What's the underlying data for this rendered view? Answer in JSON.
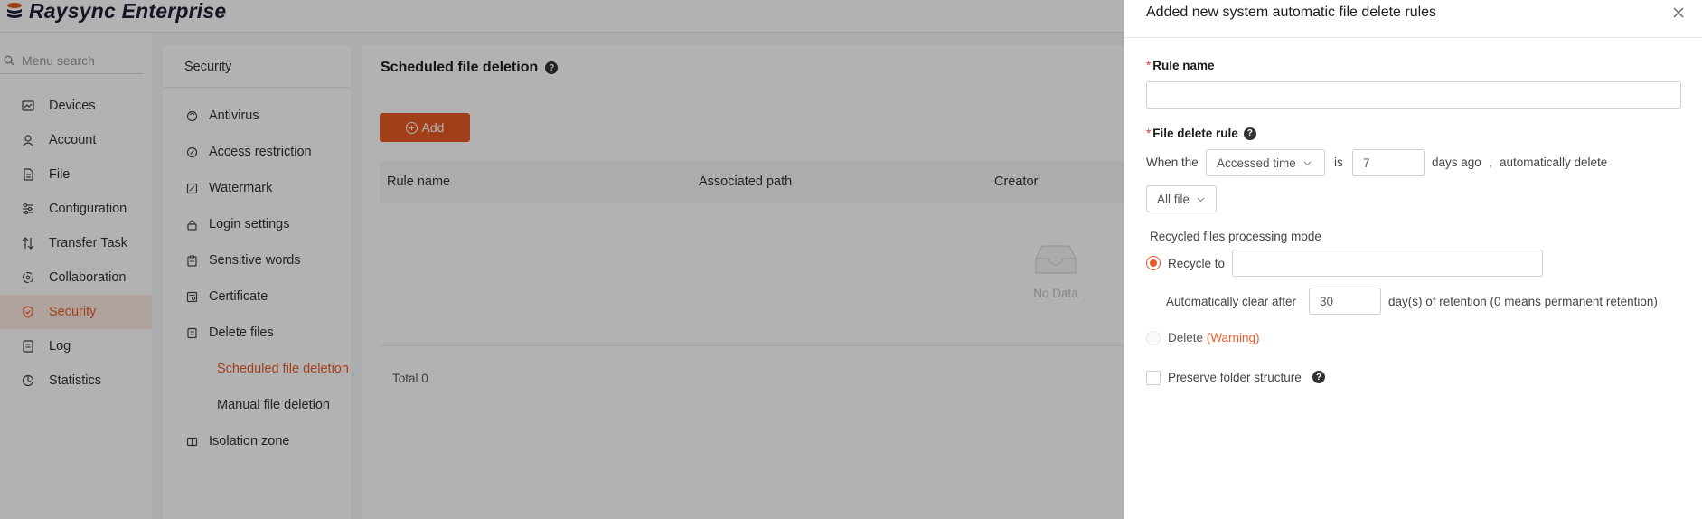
{
  "app": {
    "title": "Raysync Enterprise"
  },
  "sidebar": {
    "search_placeholder": "Menu search",
    "items": [
      {
        "label": "Devices",
        "icon": "devices-icon"
      },
      {
        "label": "Account",
        "icon": "user-icon"
      },
      {
        "label": "File",
        "icon": "file-icon"
      },
      {
        "label": "Configuration",
        "icon": "sliders-icon"
      },
      {
        "label": "Transfer Task",
        "icon": "transfer-icon"
      },
      {
        "label": "Collaboration",
        "icon": "collaboration-icon"
      },
      {
        "label": "Security",
        "icon": "shield-icon",
        "active": true
      },
      {
        "label": "Log",
        "icon": "log-icon"
      },
      {
        "label": "Statistics",
        "icon": "pie-chart-icon"
      }
    ]
  },
  "subnav": {
    "title": "Security",
    "items": [
      {
        "label": "Antivirus",
        "icon": "antivirus-icon"
      },
      {
        "label": "Access restriction",
        "icon": "restriction-icon"
      },
      {
        "label": "Watermark",
        "icon": "watermark-icon"
      },
      {
        "label": "Login settings",
        "icon": "lock-icon"
      },
      {
        "label": "Sensitive words",
        "icon": "clipboard-icon"
      },
      {
        "label": "Certificate",
        "icon": "certificate-icon"
      },
      {
        "label": "Delete files",
        "icon": "trash-icon"
      },
      {
        "label": "Scheduled file deletion",
        "child": true,
        "active": true
      },
      {
        "label": "Manual file deletion",
        "child": true
      },
      {
        "label": "Isolation zone",
        "icon": "isolation-icon"
      }
    ]
  },
  "main": {
    "title": "Scheduled file deletion",
    "add_label": "Add",
    "columns": [
      "Rule name",
      "Associated path",
      "Creator"
    ],
    "empty_text": "No Data",
    "total": "Total 0"
  },
  "drawer": {
    "title": "Added new system automatic file delete rules",
    "rule_name_label": "Rule name",
    "rule_name_value": "",
    "delete_rule_label": "File delete rule",
    "when_the": "When the",
    "time_select": "Accessed time",
    "is": "is",
    "days_value": "7",
    "days_ago": "days ago",
    "comma": ",",
    "automatically_delete": "automatically delete",
    "file_select": "All file",
    "recycled_mode_label": "Recycled files processing mode",
    "recycle_to_label": "Recycle to",
    "recycle_to_value": "",
    "auto_clear_label": "Automatically clear after",
    "auto_clear_value": "30",
    "retention_note": "day(s) of retention (0 means permanent retention)",
    "delete_label": "Delete",
    "warning": "(Warning)",
    "preserve_label": "Preserve folder structure"
  },
  "colors": {
    "accent": "#e85b28",
    "required": "#e83a3a",
    "overlay": "rgba(0,0,0,0.3)"
  }
}
